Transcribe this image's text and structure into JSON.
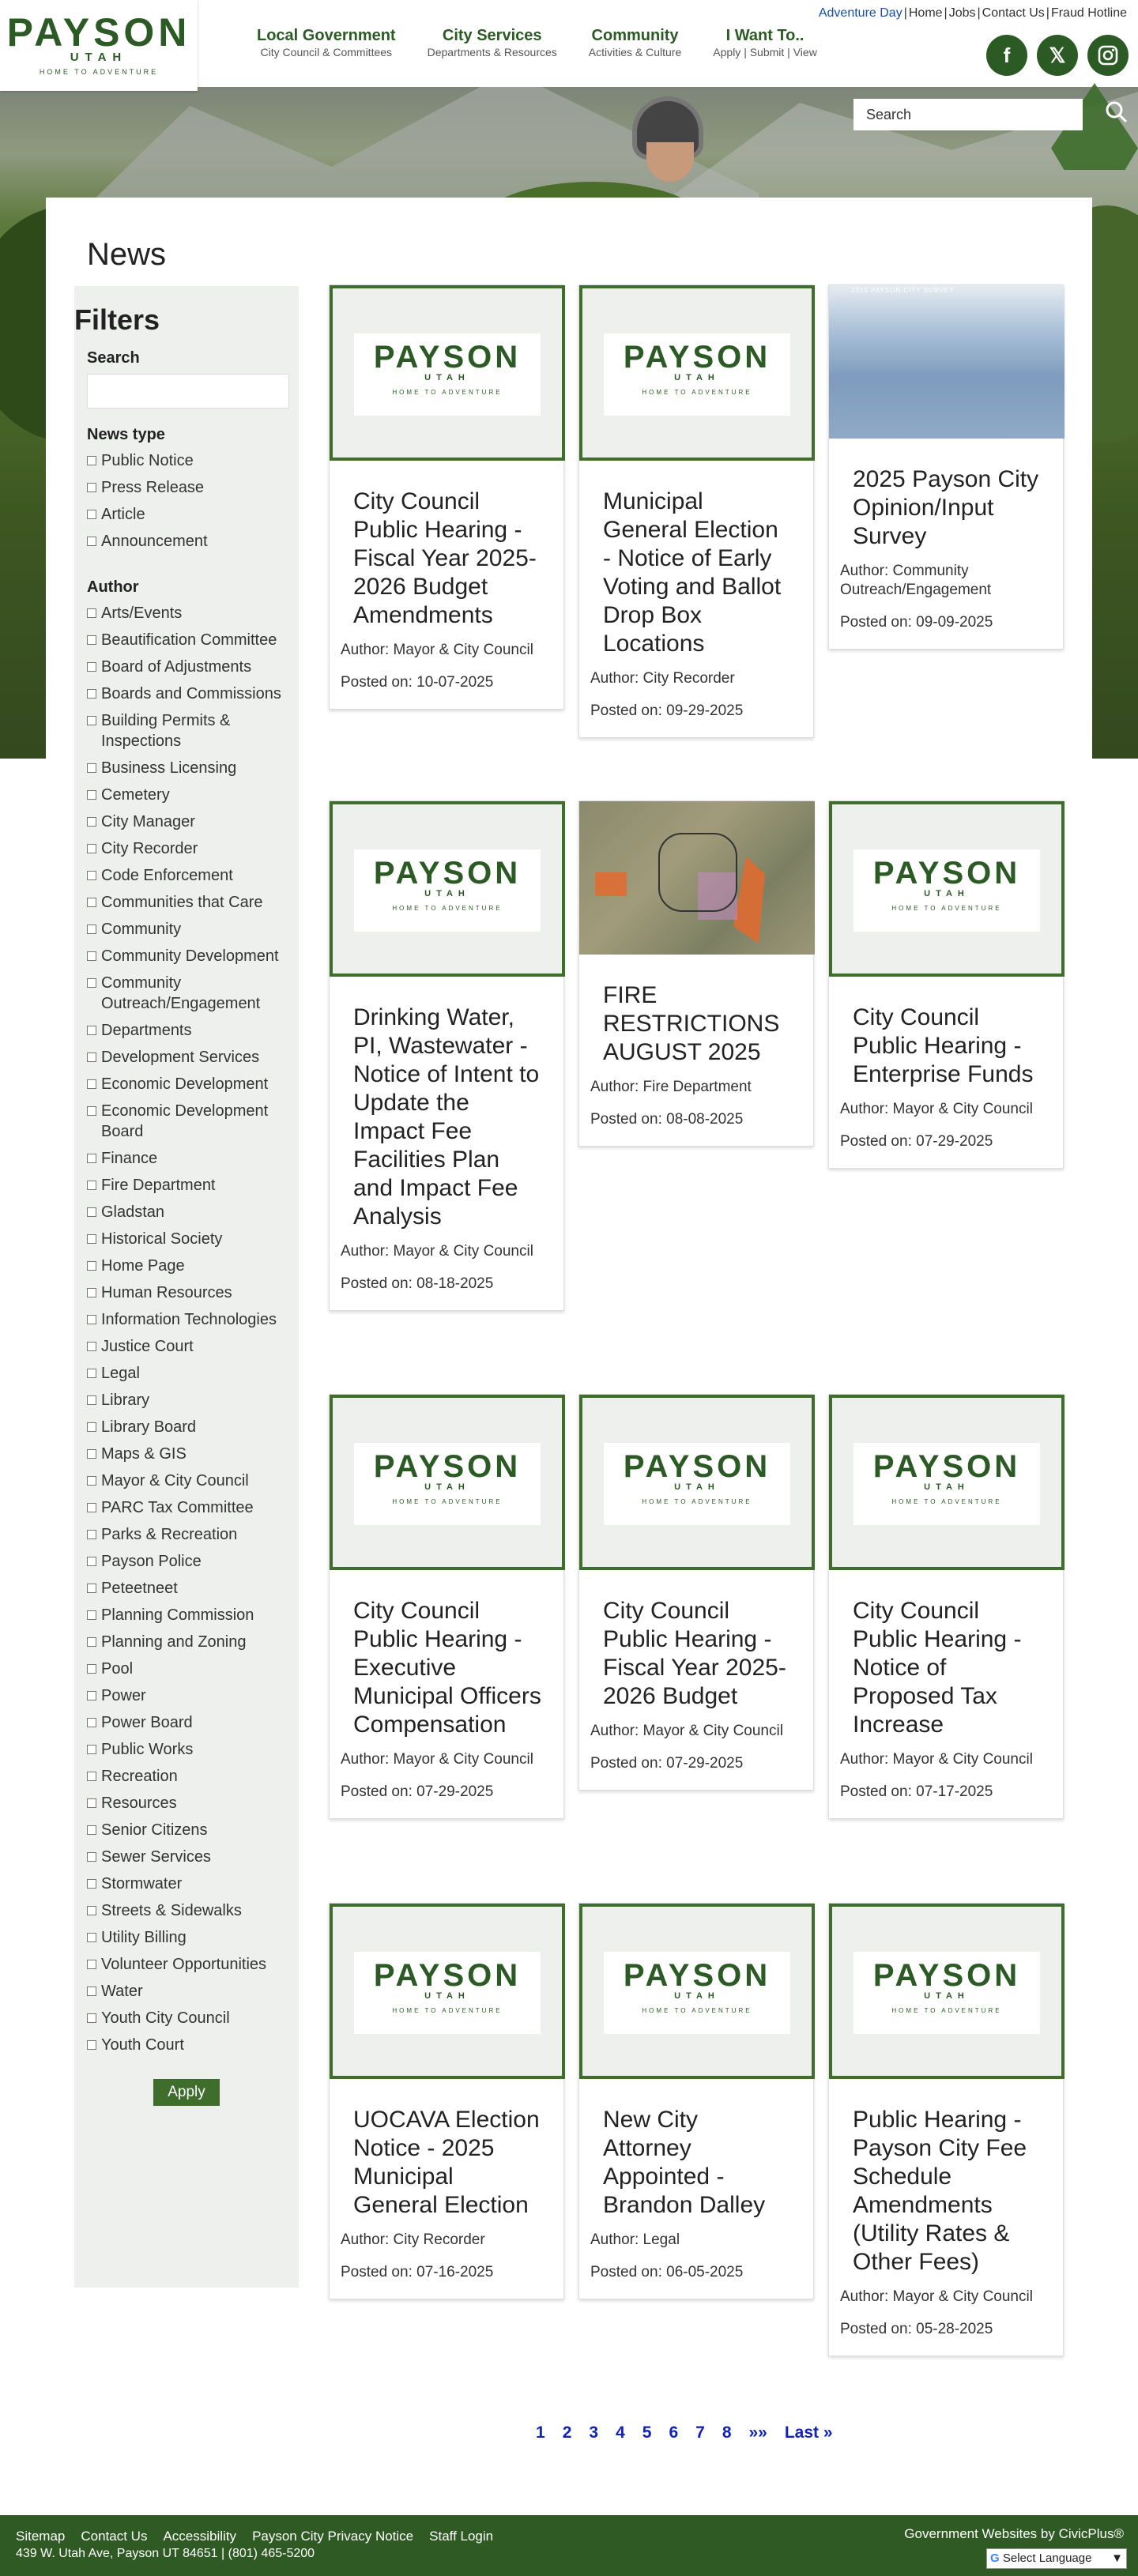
{
  "header": {
    "logo": {
      "name": "PAYSON",
      "state": "UTAH",
      "tagline": "HOME TO ADVENTURE"
    },
    "toplinks": [
      "Adventure Day",
      "Home",
      "Jobs",
      "Contact Us",
      "Fraud Hotline"
    ],
    "nav": [
      {
        "title": "Local Government",
        "sub": "City Council & Committees"
      },
      {
        "title": "City Services",
        "sub": "Departments & Resources"
      },
      {
        "title": "Community",
        "sub": "Activities & Culture"
      },
      {
        "title": "I Want To..",
        "sub": "Apply | Submit | View"
      }
    ],
    "social": [
      "facebook-icon",
      "x-icon",
      "instagram-icon"
    ],
    "search_placeholder": "Search"
  },
  "page_title": "News",
  "filters": {
    "title": "Filters",
    "search_label": "Search",
    "news_type_label": "News type",
    "news_types": [
      "Public Notice",
      "Press Release",
      "Article",
      "Announcement"
    ],
    "author_label": "Author",
    "authors": [
      "Arts/Events",
      "Beautification Committee",
      "Board of Adjustments",
      "Boards and Commissions",
      "Building Permits & Inspections",
      "Business Licensing",
      "Cemetery",
      "City Manager",
      "City Recorder",
      "Code Enforcement",
      "Communities that Care",
      "Community",
      "Community Development",
      "Community Outreach/Engagement",
      "Departments",
      "Development Services",
      "Economic Development",
      "Economic Development Board",
      "Finance",
      "Fire Department",
      "Gladstan",
      "Historical Society",
      "Home Page",
      "Human Resources",
      "Information Technologies",
      "Justice Court",
      "Legal",
      "Library",
      "Library Board",
      "Maps & GIS",
      "Mayor & City Council",
      "PARC Tax Committee",
      "Parks & Recreation",
      "Payson Police",
      "Peteetneet",
      "Planning Commission",
      "Planning and Zoning",
      "Pool",
      "Power",
      "Power Board",
      "Public Works",
      "Recreation",
      "Resources",
      "Senior Citizens",
      "Sewer Services",
      "Stormwater",
      "Streets & Sidewalks",
      "Utility Billing",
      "Volunteer Opportunities",
      "Water",
      "Youth City Council",
      "Youth Court"
    ],
    "apply_label": "Apply"
  },
  "cards": [
    {
      "title": "City Council Public Hearing - Fiscal Year 2025-2026 Budget Amendments",
      "author_label": "Author:",
      "author": "Mayor & City Council",
      "date": "Posted on: 10-07-2025"
    },
    {
      "title": "Municipal General Election - Notice of Early Voting and Ballot Drop Box Locations",
      "author_label": "Author:",
      "author": "City Recorder",
      "date": "Posted on: 09-29-2025"
    },
    {
      "title": "2025 Payson City Opinion/Input Survey",
      "author_label": "Author:",
      "author": "Community Outreach/Engagement",
      "date": "Posted on: 09-09-2025",
      "photo_caption": "2025 PAYSON CITY SURVEY"
    },
    {
      "title": "Drinking Water, PI, Wastewater - Notice of Intent to Update the Impact Fee Facilities Plan and Impact Fee Analysis",
      "author_label": "Author:",
      "author": "Mayor & City Council",
      "date": "Posted on: 08-18-2025"
    },
    {
      "title": "FIRE RESTRICTIONS AUGUST 2025",
      "author_label": "Author:",
      "author": "Fire Department",
      "date": "Posted on: 08-08-2025"
    },
    {
      "title": "City Council Public Hearing - Enterprise Funds",
      "author_label": "Author:",
      "author": "Mayor & City Council",
      "date": "Posted on: 07-29-2025"
    },
    {
      "title": "City Council Public Hearing - Executive Municipal Officers Compensation",
      "author_label": "Author:",
      "author": "Mayor & City Council",
      "date": "Posted on: 07-29-2025"
    },
    {
      "title": "City Council Public Hearing - Fiscal Year 2025-2026 Budget",
      "author_label": "Author:",
      "author": "Mayor & City Council",
      "date": "Posted on: 07-29-2025"
    },
    {
      "title": "City Council Public Hearing - Notice of Proposed Tax Increase",
      "author_label": "Author:",
      "author": "Mayor & City Council",
      "date": "Posted on: 07-17-2025"
    },
    {
      "title": "UOCAVA Election Notice - 2025 Municipal General Election",
      "author_label": "Author:",
      "author": "City Recorder",
      "date": "Posted on: 07-16-2025"
    },
    {
      "title": "New City Attorney Appointed - Brandon Dalley",
      "author_label": "Author:",
      "author": "Legal",
      "date": "Posted on: 06-05-2025"
    },
    {
      "title": "Public Hearing - Payson City Fee Schedule Amendments (Utility Rates & Other Fees)",
      "author_label": "Author:",
      "author": "Mayor & City Council",
      "date": "Posted on: 05-28-2025"
    }
  ],
  "pagination": [
    "1",
    "2",
    "3",
    "4",
    "5",
    "6",
    "7",
    "8",
    "»»",
    "Last »"
  ],
  "footer": {
    "links": [
      "Sitemap",
      "Contact Us",
      "Accessibility",
      "Payson City Privacy Notice",
      "Staff Login"
    ],
    "address": "439 W. Utah Ave, Payson UT 84651 | (801) 465-5200",
    "credit": "Government Websites by CivicPlus®",
    "language": "Select Language"
  }
}
